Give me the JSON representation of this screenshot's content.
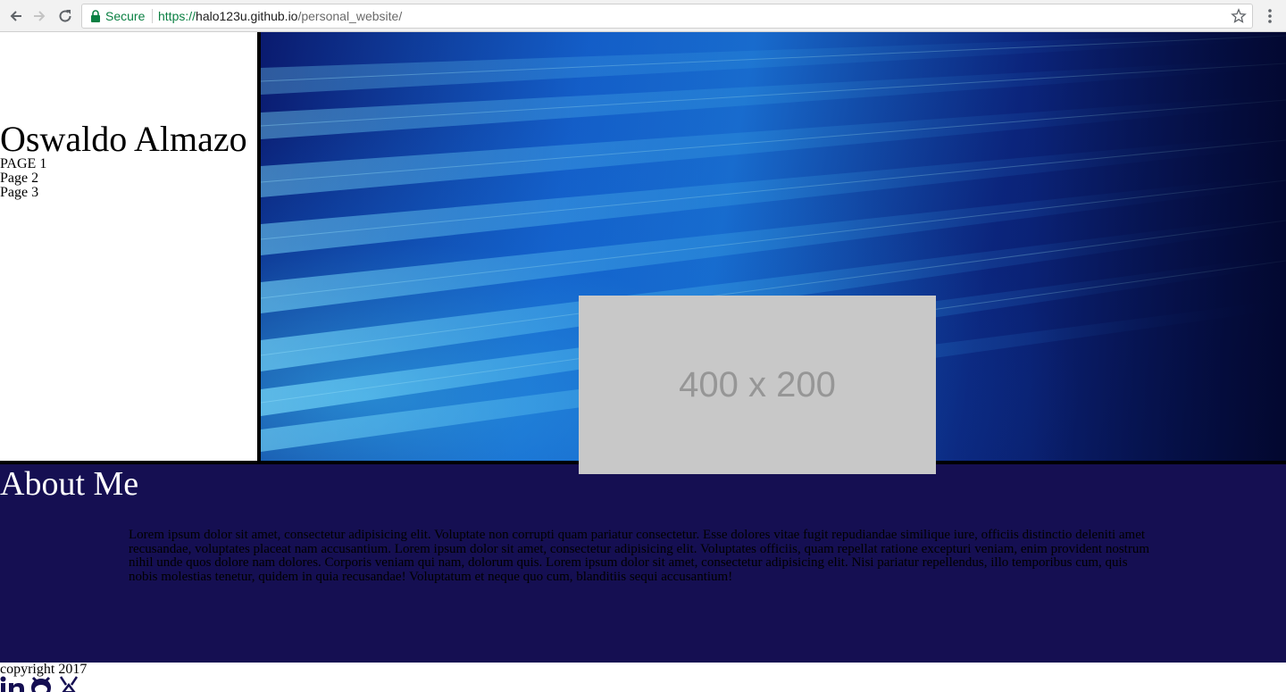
{
  "browser": {
    "secure_label": "Secure",
    "url_scheme": "https://",
    "url_host": "halo123u.github.io",
    "url_path": "/personal_website/"
  },
  "header": {
    "name": "Oswaldo Almazo",
    "nav": [
      "PAGE 1",
      "Page 2",
      "Page 3"
    ]
  },
  "hero": {
    "placeholder_label": "400 x 200"
  },
  "about": {
    "title": "About Me",
    "text": "Lorem ipsum dolor sit amet, consectetur adipisicing elit. Voluptate non corrupti quam pariatur consectetur. Esse dolores vitae fugit repudiandae similique iure, officiis distinctio deleniti amet recusandae, voluptates placeat nam accusantium. Lorem ipsum dolor sit amet, consectetur adipisicing elit. Voluptates officiis, quam repellat ratione excepturi veniam, enim provident nostrum nihil unde quos dolore nam dolores. Corporis veniam qui nam, dolorum quis. Lorem ipsum dolor sit amet, consectetur adipisicing elit. Nisi pariatur repellendus, illo temporibus cum, quis nobis molestias tenetur, quidem in quia recusandae! Voluptatum et neque quo cum, blanditiis sequi accusantium!"
  },
  "footer": {
    "copyright": "copyright 2017",
    "social_icons": [
      "linkedin-icon",
      "github-icon",
      "devpost-icon"
    ]
  },
  "colors": {
    "about_bg": "#150f52",
    "secure_green": "#0b8043",
    "placeholder_bg": "#c8c8c8"
  }
}
